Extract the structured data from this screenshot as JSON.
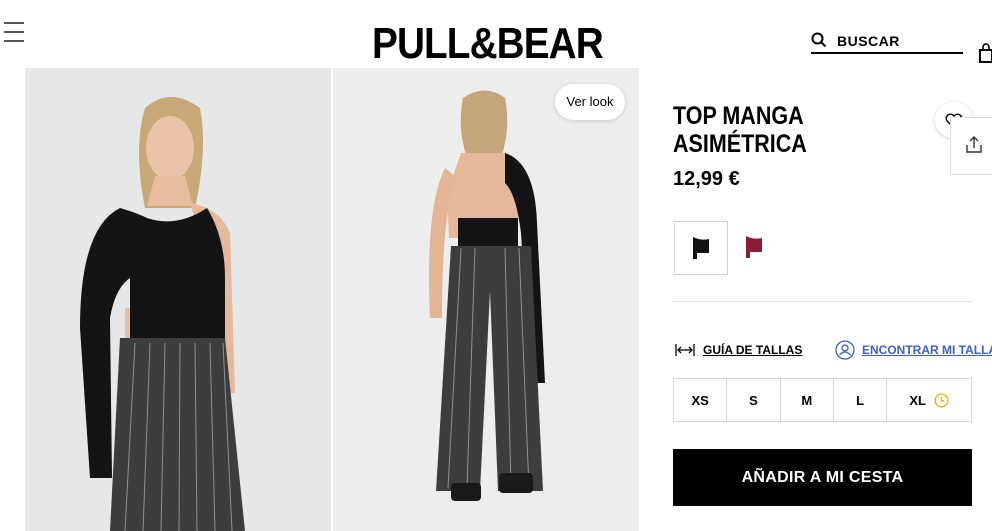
{
  "header": {
    "logo": "PULL&BEAR",
    "search_label": "BUSCAR"
  },
  "gallery": {
    "ver_look_label": "Ver look"
  },
  "product": {
    "title_line1": "TOP MANGA",
    "title_line2": "ASIMÉTRICA",
    "price": "12,99 €",
    "colors": [
      {
        "name": "black",
        "hex": "#111111",
        "selected": true
      },
      {
        "name": "burgundy",
        "hex": "#8b1d33",
        "selected": false
      }
    ],
    "size_guide_label": "GUÍA DE TALLAS",
    "find_size_label": "ENCONTRAR MI TALLA",
    "sizes": [
      "XS",
      "S",
      "M",
      "L",
      "XL"
    ],
    "add_to_cart_label": "AÑADIR A MI CESTA"
  },
  "colors": {
    "accent_link": "#3b62c4",
    "button_bg": "#000000",
    "low_stock_icon": "#e6b800"
  }
}
